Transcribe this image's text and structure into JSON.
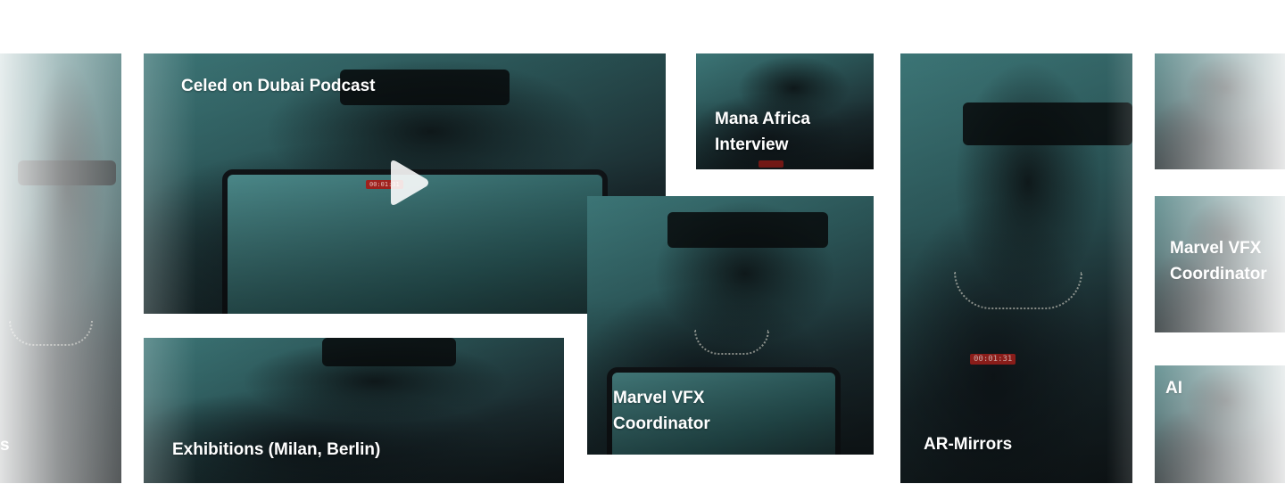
{
  "tiles": {
    "left_edge": {
      "label": "s"
    },
    "dubai_podcast": {
      "label": "Celed on Dubai Podcast",
      "rec": "00:01:31"
    },
    "exhibitions": {
      "label": "Exhibitions (Milan, Berlin)"
    },
    "mana_africa": {
      "label": "Mana Africa\nInterview"
    },
    "marvel_center": {
      "label": "Marvel VFX\nCoordinator"
    },
    "ar_mirrors": {
      "label": "AR-Mirrors",
      "rec": "00:01:31"
    },
    "marvel_right": {
      "label": "Marvel VFX\nCoordinator"
    },
    "ai": {
      "label": "AI"
    }
  },
  "icons": {
    "play": "play-icon"
  },
  "colors": {
    "tile_teal": "#3f7b7c",
    "tile_dark": "#131b1e",
    "label": "#ffffff",
    "rec_badge": "#a8231f"
  }
}
